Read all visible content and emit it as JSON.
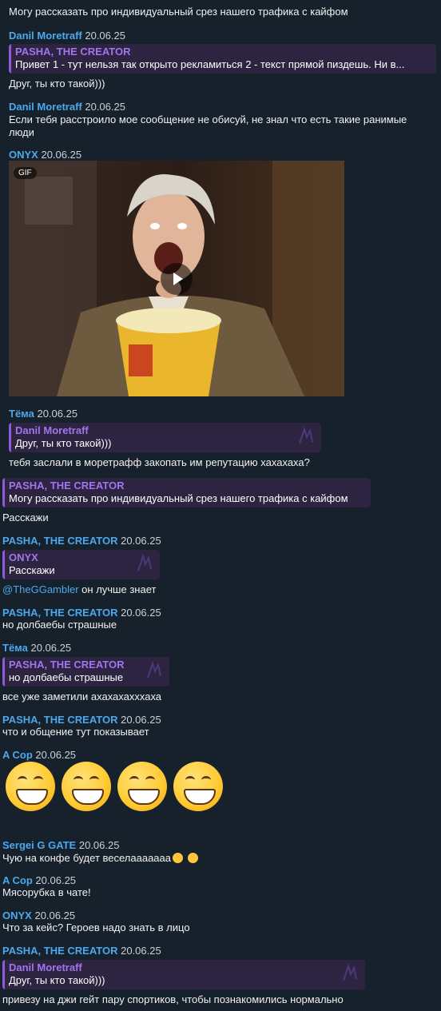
{
  "messages": {
    "m0_text": "Могу рассказать про индивидуальный срез нашего трафика с кайфом",
    "m1_author": "Danil Moretraff",
    "m1_date": "20.06.25",
    "m1_quote_name": "PASHA, THE CREATOR",
    "m1_quote_text": "Привет   1 - тут нельзя так открыто рекламиться 2 - текст прямой пиздешь. Ни в...",
    "m1_text": "Друг, ты кто такой)))",
    "m2_author": "Danil Moretraff",
    "m2_date": "20.06.25",
    "m2_text_line1": "Если тебя расстроило мое сообщение не обисуй, не знал что есть такие ранимые",
    "m2_text_line2": "люди",
    "m3_author": "ONYX",
    "m3_date": "20.06.25",
    "m3_gif_badge": "GIF",
    "m4_author": "Тёма",
    "m4_date": "20.06.25",
    "m4_quote_name": "Danil Moretraff",
    "m4_quote_text": "Друг, ты кто такой)))",
    "m4_text": "тебя заслали в моретрафф закопать им репутацию хахахаха?",
    "m5_quote_name": "PASHA, THE CREATOR",
    "m5_quote_text": "Могу рассказать про индивидуальный срез нашего трафика с кайфом",
    "m5_text": "Расскажи",
    "m6_author": "PASHA, THE CREATOR",
    "m6_date": "20.06.25",
    "m6_quote_name": "ONYX",
    "m6_quote_text": "Расскажи",
    "m6_mention": "@TheGGambler",
    "m6_text": " он лучше знает",
    "m7_author": "PASHA, THE CREATOR",
    "m7_date": "20.06.25",
    "m7_text": "но долбаебы страшные",
    "m8_author": "Тёма",
    "m8_date": "20.06.25",
    "m8_quote_name": "PASHA, THE CREATOR",
    "m8_quote_text": "но долбаебы страшные",
    "m8_text": "все уже заметили ахахахахххаха",
    "m9_author": "PASHA, THE CREATOR",
    "m9_date": "20.06.25",
    "m9_text": "что и общение тут показывает",
    "m10_author": "A Cop",
    "m10_date": "20.06.25",
    "m11_author": "Sergei G GATE",
    "m11_date": "20.06.25",
    "m11_text": "Чую на конфе будет веселааааааа",
    "m12_author": "A Cop",
    "m12_date": "20.06.25",
    "m12_text": "Мясорубка в чате!",
    "m13_author": "ONYX",
    "m13_date": "20.06.25",
    "m13_text": "Что за кейс? Героев надо знать в лицо",
    "m14_author": "PASHA, THE CREATOR",
    "m14_date": "20.06.25",
    "m14_quote_name": "Danil Moretraff",
    "m14_quote_text": "Друг, ты кто такой)))",
    "m14_text": "привезу на джи гейт пару спортиков, чтобы познакомились нормально"
  },
  "colors": {
    "background": "#17212b",
    "author": "#4aa8ee",
    "quote_name": "#a374ec",
    "quote_bg": "#2c2440"
  },
  "icons": {
    "gif_play": "play-icon",
    "emoji": "grinning-face-icon"
  }
}
